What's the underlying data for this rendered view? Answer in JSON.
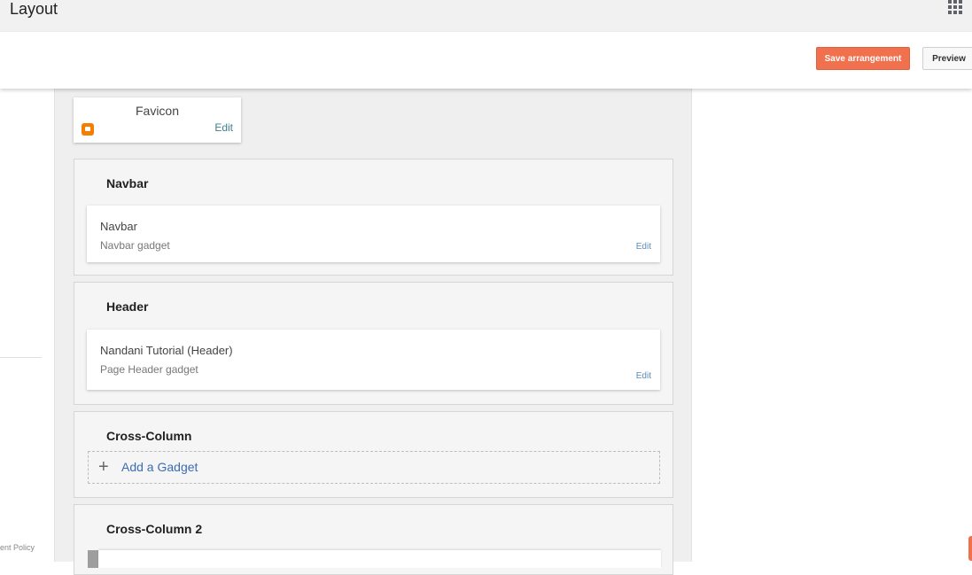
{
  "header": {
    "title": "Layout"
  },
  "actions": {
    "save_label": "Save arrangement",
    "preview_label": "Preview"
  },
  "sidebar": {
    "policy_fragment": "ent Policy"
  },
  "favicon": {
    "title": "Favicon",
    "edit_label": "Edit"
  },
  "sections": [
    {
      "title": "Navbar",
      "gadget": {
        "title": "Navbar",
        "subtitle": "Navbar gadget",
        "edit_label": "Edit"
      }
    },
    {
      "title": "Header",
      "gadget": {
        "title": "Nandani Tutorial (Header)",
        "subtitle": "Page Header gadget",
        "edit_label": "Edit"
      }
    },
    {
      "title": "Cross-Column",
      "add_gadget_label": "Add a Gadget"
    },
    {
      "title": "Cross-Column 2"
    }
  ],
  "colors": {
    "accent": "#f1714f",
    "link": "#3c6cb4",
    "canvas_bg": "#efefef"
  },
  "icons": {
    "apps": "apps-grid-icon",
    "favicon": "blogger-icon",
    "add": "plus-icon"
  }
}
